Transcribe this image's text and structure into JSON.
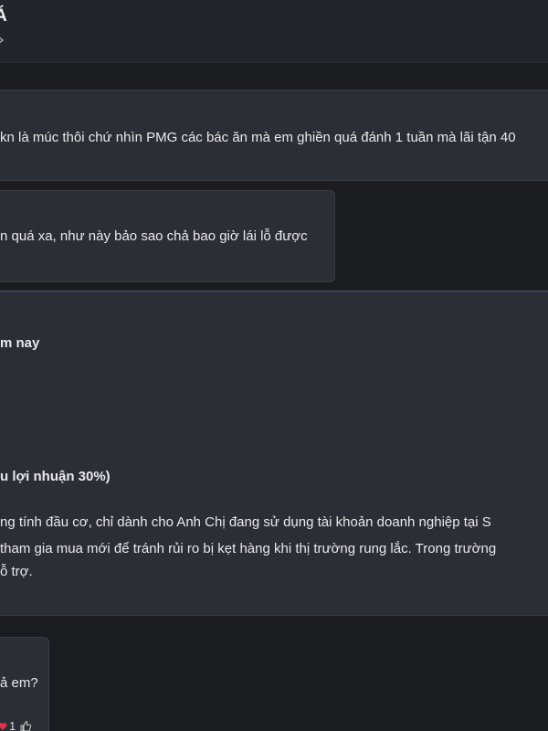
{
  "header": {
    "title": "Á"
  },
  "messages": {
    "m1": {
      "text": "kn là múc thôi chứ nhìn PMG các bác ăn mà em ghiền quá đánh 1 tuần mà lãi tận 40"
    },
    "m2": {
      "text": "n quá xa, như này bảo sao chả bao giờ lái lỗ được"
    },
    "m3": {
      "line1": "m nay",
      "line2": "u lợi nhuận 30%)",
      "line3": "ng tính đầu cơ, chỉ dành cho Anh Chị  đang sử dụng tài khoản doanh nghiệp tại S",
      "line4": "tham gia mua mới để tránh rủi ro bị kẹt hàng khi thị trường rung lắc. Trong trường",
      "line5": "ỗ trợ."
    },
    "m4": {
      "text": "ả em?",
      "reaction_count": "1"
    }
  },
  "colors": {
    "background": "#1b1c20",
    "header": "#23252a",
    "bubble": "#2b2e34",
    "reaction_heart": "#e0334a"
  },
  "icons": [
    "chevron-right-icon",
    "heart-icon",
    "like-icon"
  ]
}
